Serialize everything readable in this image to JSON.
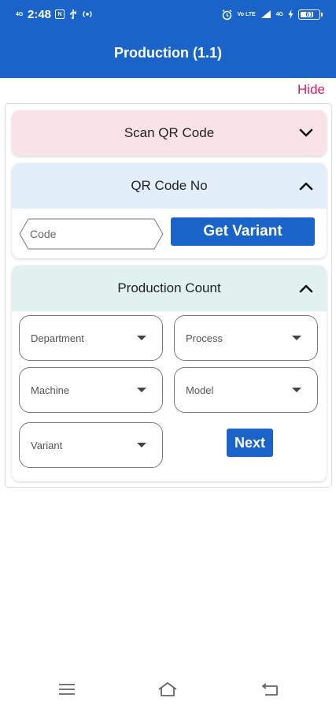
{
  "status_bar": {
    "time": "2:48",
    "network": "4G",
    "volte": "Vo LTE",
    "network_right": "4G",
    "battery": "61"
  },
  "app_bar": {
    "title": "Production (1.1)"
  },
  "hide_link": "Hide",
  "scan_section": {
    "title": "Scan QR Code",
    "expanded": false
  },
  "qr_section": {
    "title": "QR Code No",
    "expanded": true,
    "code_placeholder": "Code",
    "code_value": "",
    "get_variant_label": "Get Variant"
  },
  "production_section": {
    "title": "Production Count",
    "expanded": true,
    "department": "Department",
    "process": "Process",
    "machine": "Machine",
    "model": "Model",
    "variant": "Variant",
    "next_label": "Next"
  },
  "colors": {
    "primary": "#1a63c8",
    "hide_link": "#d81b60",
    "scan_header_bg": "#f9e3e8",
    "qr_header_bg": "#e3eefb",
    "production_header_bg": "#e0f1ef"
  },
  "icons": {
    "scan_chevron": "chevron-down-icon",
    "qr_chevron": "chevron-up-icon",
    "production_chevron": "chevron-up-icon",
    "nav_menu": "menu-icon",
    "nav_home": "home-icon",
    "nav_back": "back-icon"
  }
}
